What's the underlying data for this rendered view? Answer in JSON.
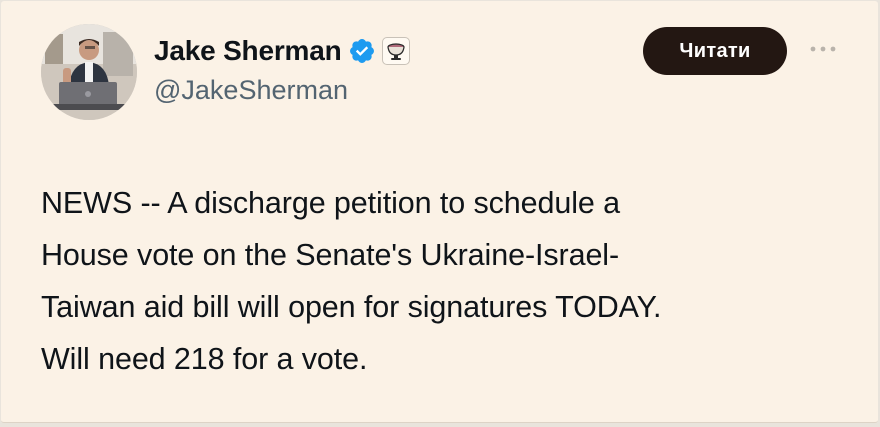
{
  "author": {
    "display_name": "Jake Sherman",
    "handle": "@JakeSherman",
    "verified": true,
    "avatar_icon": "person-at-laptop-avatar",
    "affiliation_icon": "punchbowl-affiliation-icon"
  },
  "actions": {
    "follow_label": "Читати",
    "more_icon": "more-options-icon"
  },
  "tweet": {
    "lines": [
      "NEWS -- A discharge petition to schedule a",
      "House vote on the Senate's Ukraine-Israel-",
      "Taiwan aid bill will open for signatures TODAY.",
      "Will need 218 for a vote."
    ]
  },
  "colors": {
    "background": "#fbf2e6",
    "text": "#0f1419",
    "secondary_text": "#536471",
    "button_bg": "#231712",
    "verified_badge": "#1d9bf0"
  }
}
